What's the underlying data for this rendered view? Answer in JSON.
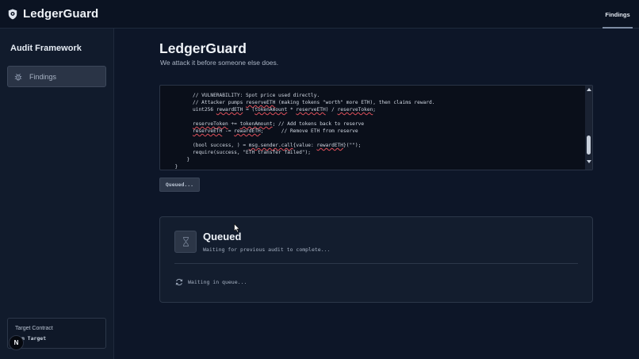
{
  "app": {
    "name": "LedgerGuard"
  },
  "topnav": {
    "tabs": [
      {
        "label": "Findings",
        "active": true
      }
    ]
  },
  "sidebar": {
    "title": "Audit Framework",
    "items": [
      {
        "label": "Findings",
        "icon": "bug-icon",
        "active": true
      }
    ],
    "target": {
      "label": "Target Contract",
      "value": "tom Target"
    }
  },
  "header": {
    "title": "LedgerGuard",
    "subtitle": "We attack it before someone else does."
  },
  "code": {
    "lines": [
      {
        "indent": 8,
        "parts": [
          {
            "t": "// VULNERABILITY: Spot price used directly."
          }
        ]
      },
      {
        "indent": 8,
        "parts": [
          {
            "t": "// Attacker pumps "
          },
          {
            "t": "reserveETH",
            "u": true
          },
          {
            "t": " (making tokens \"worth\" more ETH), then claims reward."
          }
        ]
      },
      {
        "indent": 8,
        "parts": [
          {
            "t": "uint256 "
          },
          {
            "t": "rewardETH",
            "u": true
          },
          {
            "t": " = ("
          },
          {
            "t": "tokenAmount",
            "u": true
          },
          {
            "t": " * "
          },
          {
            "t": "reserveETH",
            "u": true
          },
          {
            "t": ") / "
          },
          {
            "t": "reserveToken",
            "u": true
          },
          {
            "t": ";"
          }
        ]
      },
      {
        "indent": 0,
        "parts": [
          {
            "t": ""
          }
        ]
      },
      {
        "indent": 8,
        "parts": [
          {
            "t": "reserveToken",
            "u": true
          },
          {
            "t": " += "
          },
          {
            "t": "tokenAmount",
            "u": true
          },
          {
            "t": "; // Add tokens back to reserve"
          }
        ]
      },
      {
        "indent": 8,
        "parts": [
          {
            "t": "reserveETH",
            "u": true
          },
          {
            "t": " -= "
          },
          {
            "t": "rewardETH",
            "u": true
          },
          {
            "t": ";      // Remove ETH from reserve"
          }
        ]
      },
      {
        "indent": 0,
        "parts": [
          {
            "t": ""
          }
        ]
      },
      {
        "indent": 8,
        "parts": [
          {
            "t": "(bool success, ) = "
          },
          {
            "t": "msg.sender.call",
            "u": true
          },
          {
            "t": "{value: "
          },
          {
            "t": "rewardETH",
            "u": true
          },
          {
            "t": "}(\"\");"
          }
        ]
      },
      {
        "indent": 8,
        "parts": [
          {
            "t": "require(success, \"ETH transfer failed\");"
          }
        ]
      },
      {
        "indent": 6,
        "parts": [
          {
            "t": "}"
          }
        ]
      },
      {
        "indent": 2,
        "parts": [
          {
            "t": "}"
          }
        ]
      }
    ]
  },
  "action": {
    "button_label": "Queued..."
  },
  "status": {
    "title": "Queued",
    "subtitle": "Waiting for previous audit to complete...",
    "wait_text": "Waiting in queue...",
    "icon": "hourglass-icon"
  },
  "badge": {
    "label": "N"
  },
  "colors": {
    "background": "#0d1628",
    "panel": "#131d2e",
    "code_bg": "#0a0f1a",
    "error_underline": "#e0505a"
  }
}
